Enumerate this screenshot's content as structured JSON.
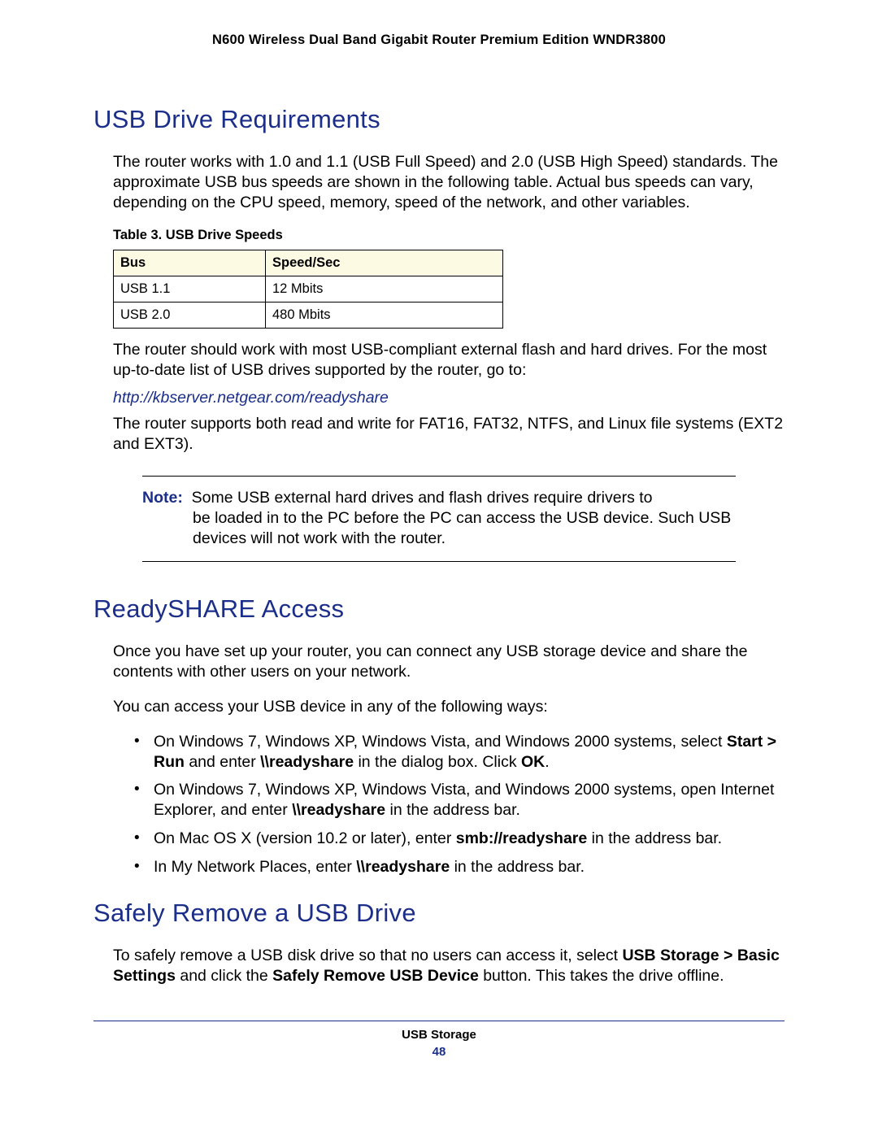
{
  "header": "N600 Wireless Dual Band Gigabit Router Premium Edition WNDR3800",
  "sections": {
    "usb_req": {
      "title": "USB Drive Requirements",
      "intro": "The router works with 1.0 and 1.1 (USB Full Speed) and 2.0 (USB High Speed) standards. The approximate USB bus speeds are shown in the following table. Actual bus speeds can vary, depending on the CPU speed, memory, speed of the network, and other variables.",
      "table_caption": "Table 3.  USB Drive Speeds",
      "table_headers": {
        "c1": "Bus",
        "c2": "Speed/Sec"
      },
      "table_rows": [
        {
          "c1": "USB 1.1",
          "c2": "12 Mbits"
        },
        {
          "c1": "USB 2.0",
          "c2": "480 Mbits"
        }
      ],
      "after_table": "The router should work with most USB-compliant external flash and hard drives. For the most up-to-date list of USB drives supported by the router, go to:",
      "link": "http://kbserver.netgear.com/readyshare",
      "filesystems": "The router supports both read and write for FAT16, FAT32, NTFS, and Linux file systems (EXT2 and EXT3).",
      "note_label": "Note:",
      "note_text_line1": "Some USB external hard drives and flash drives require drivers to",
      "note_text_rest": "be loaded in to the PC before the PC can access the USB device. Such USB devices will not work with the router."
    },
    "readyshare": {
      "title": "ReadySHARE Access",
      "p1": "Once you have set up your router, you can connect any USB storage device and share the contents with other users on your network.",
      "p2": "You can access your USB device in any of the following ways:",
      "items": [
        {
          "pre": "On Windows 7, Windows XP, Windows Vista, and Windows 2000 systems, select ",
          "b1": "Start > Run",
          "mid1": " and enter ",
          "b2": "\\\\readyshare",
          "mid2": " in the dialog box. Click ",
          "b3": "OK",
          "post": "."
        },
        {
          "pre": "On Windows 7, Windows XP, Windows Vista, and Windows 2000 systems, open Internet Explorer, and enter ",
          "b1": "\\\\readyshare",
          "post": " in the address bar."
        },
        {
          "pre": "On Mac OS X (version 10.2 or later), enter ",
          "b1": "smb://readyshare",
          "post": " in the address bar."
        },
        {
          "pre": "In My Network Places, enter ",
          "b1": "\\\\readyshare",
          "post": " in the address bar."
        }
      ]
    },
    "safely": {
      "title": "Safely Remove a USB Drive",
      "p_pre": "To safely remove a USB disk drive so that no users can access it, select ",
      "p_b1": "USB Storage > Basic Settings",
      "p_mid": " and click the ",
      "p_b2": "Safely Remove USB Device",
      "p_post": " button. This takes the drive offline."
    }
  },
  "footer": {
    "title": "USB Storage",
    "page": "48"
  }
}
